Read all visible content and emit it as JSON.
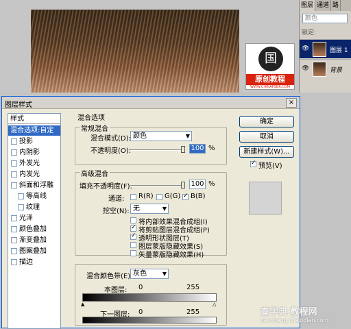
{
  "logo": {
    "glyph": "国",
    "text": "原创教程",
    "url": "WWW.CHINAPSBR.COM"
  },
  "layers_panel": {
    "tabs": [
      "图层",
      "通道",
      "路"
    ],
    "mode": "颜色",
    "lock_label": "锁定:",
    "layers": [
      {
        "name": "图层 1",
        "selected": true
      },
      {
        "name": "背景",
        "selected": false
      }
    ]
  },
  "dialog": {
    "title": "图层样式",
    "close": "×",
    "styles_list": {
      "header": "样式",
      "items": [
        {
          "label": "混合选项:自定",
          "selected": true,
          "checkbox": false,
          "checked": false
        },
        {
          "label": "投影",
          "checkbox": true,
          "checked": false
        },
        {
          "label": "内阴影",
          "checkbox": true,
          "checked": false
        },
        {
          "label": "外发光",
          "checkbox": true,
          "checked": false
        },
        {
          "label": "内发光",
          "checkbox": true,
          "checked": false
        },
        {
          "label": "斜面和浮雕",
          "checkbox": true,
          "checked": false
        },
        {
          "label": "等高线",
          "checkbox": true,
          "checked": false,
          "indent": true
        },
        {
          "label": "纹理",
          "checkbox": true,
          "checked": false,
          "indent": true
        },
        {
          "label": "光泽",
          "checkbox": true,
          "checked": false
        },
        {
          "label": "颜色叠加",
          "checkbox": true,
          "checked": false
        },
        {
          "label": "渐变叠加",
          "checkbox": true,
          "checked": false
        },
        {
          "label": "图案叠加",
          "checkbox": true,
          "checked": false
        },
        {
          "label": "描边",
          "checkbox": true,
          "checked": false
        }
      ]
    },
    "blend_options_title": "混合选项",
    "general": {
      "legend": "常规混合",
      "mode_label": "混合模式(D):",
      "mode_value": "颜色",
      "opacity_label": "不透明度(O):",
      "opacity_value": "100",
      "opacity_unit": "%"
    },
    "advanced": {
      "legend": "高级混合",
      "fill_label": "填充不透明度(F):",
      "fill_value": "100",
      "fill_unit": "%",
      "channels_label": "通道:",
      "channels": [
        {
          "label": "R(R)",
          "checked": false
        },
        {
          "label": "G(G)",
          "checked": false
        },
        {
          "label": "B(B)",
          "checked": true
        }
      ],
      "knockout_label": "挖空(N):",
      "knockout_value": "无",
      "options": [
        {
          "label": "将内部效果混合成组(I)",
          "checked": false
        },
        {
          "label": "将剪贴图层混合成组(P)",
          "checked": true
        },
        {
          "label": "透明形状图层(T)",
          "checked": true
        },
        {
          "label": "图层蒙版隐藏效果(S)",
          "checked": false
        },
        {
          "label": "矢量蒙版隐藏效果(H)",
          "checked": false
        }
      ]
    },
    "blend_if": {
      "label": "混合颜色带(E):",
      "value": "灰色",
      "this_layer_label": "本图层:",
      "this_layer_low": "0",
      "this_layer_high": "255",
      "underlying_label": "下一图层:",
      "underlying_low": "0",
      "underlying_high": "255"
    },
    "buttons": {
      "ok": "确定",
      "cancel": "取消",
      "new_style": "新建样式(W)...",
      "preview_label": "预览(V)",
      "preview_checked": true
    }
  },
  "watermark": {
    "line1": "查字典 教程网",
    "line2": "jiaocheng.chazidian.com"
  }
}
